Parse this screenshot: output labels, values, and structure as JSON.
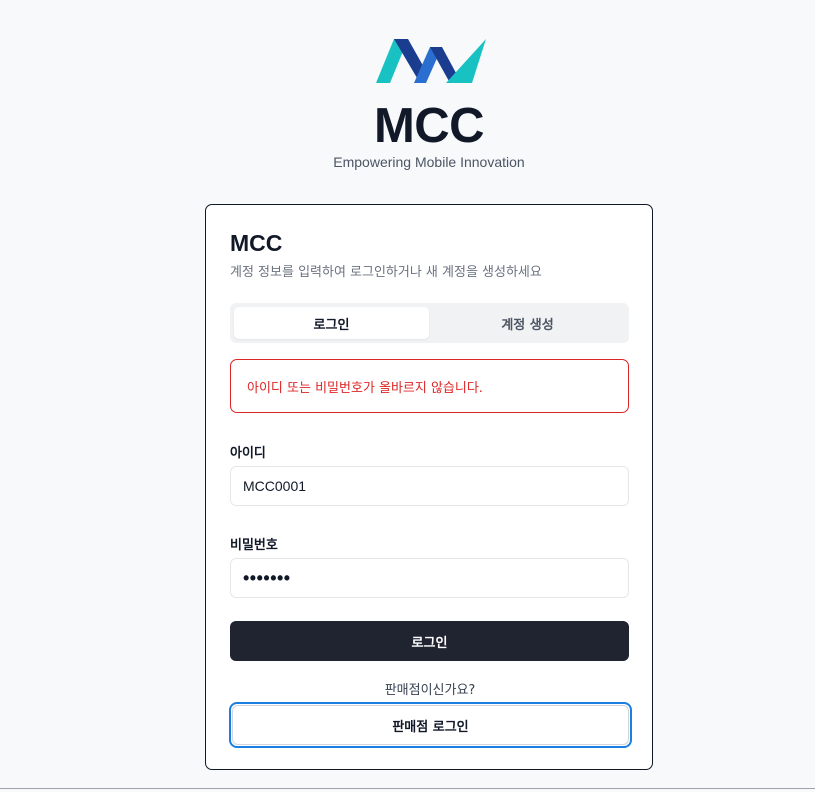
{
  "brand": {
    "logo_icon": "mcc-logo-icon",
    "title": "MCC",
    "tagline": "Empowering Mobile Innovation",
    "colors": {
      "teal": "#19c2c2",
      "navy": "#1b3d8f",
      "blue": "#2a6fcf"
    }
  },
  "card": {
    "title": "MCC",
    "subtitle": "계정 정보를 입력하여 로그인하거나 새 계정을 생성하세요",
    "tabs": [
      {
        "label": "로그인",
        "active": true
      },
      {
        "label": "계정 생성",
        "active": false
      }
    ],
    "error_message": "아이디 또는 비밀번호가 올바르지 않습니다.",
    "username": {
      "label": "아이디",
      "value": "MCC0001"
    },
    "password": {
      "label": "비밀번호",
      "value": "•••••••"
    },
    "login_button": "로그인",
    "dealer_hint": "판매점이신가요?",
    "dealer_button": "판매점 로그인"
  },
  "colors": {
    "primary_button": "#1f2430",
    "error": "#dc2626",
    "focus_ring": "#1a7fe0",
    "background": "#f8f9fb"
  }
}
